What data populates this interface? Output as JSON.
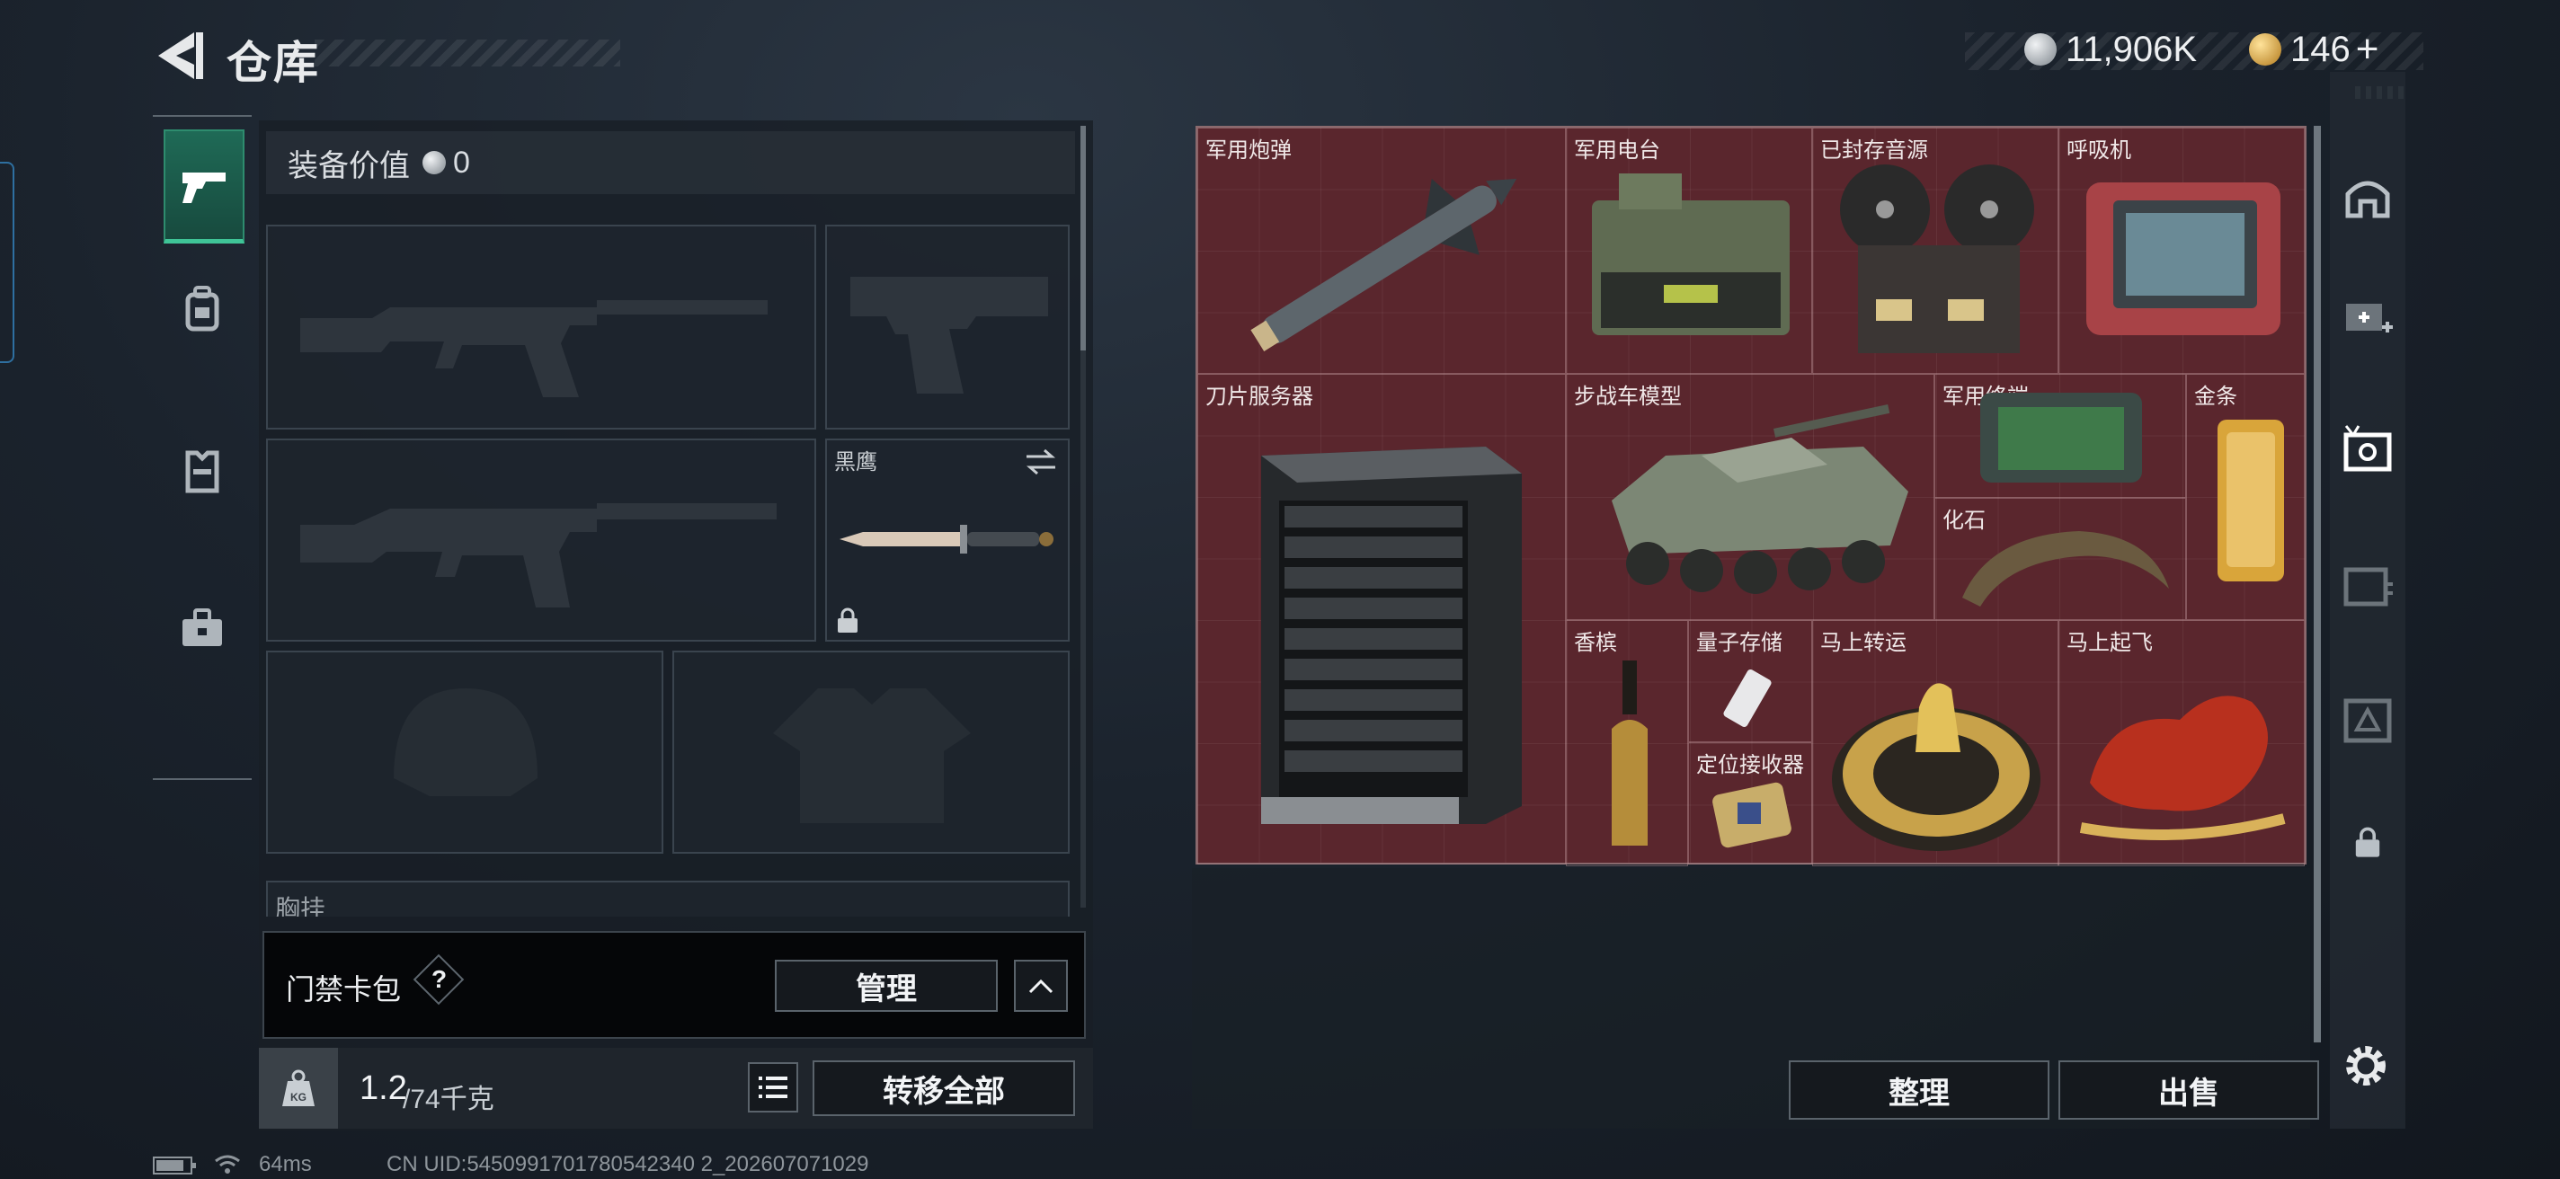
{
  "header": {
    "title": "仓库"
  },
  "currency": {
    "silver": {
      "amount": "11,906K",
      "icon": "silver-coin-icon"
    },
    "gold": {
      "amount": "146",
      "plus": "+",
      "icon": "gold-coin-icon"
    }
  },
  "sidebar_tabs": [
    {
      "name": "weapons",
      "icon": "pistol-icon",
      "active": true
    },
    {
      "name": "backpack",
      "icon": "backpack-icon",
      "active": false
    },
    {
      "name": "vest",
      "icon": "vest-icon",
      "active": false
    },
    {
      "name": "case",
      "icon": "briefcase-icon",
      "active": false
    }
  ],
  "equipment": {
    "value_label": "装备价值",
    "value": "0",
    "melee_label": "黑鹰",
    "chest_label_partial": "胸挂",
    "chest_help": "?"
  },
  "access_card": {
    "label": "门禁卡包",
    "help": "?",
    "manage_button": "管理"
  },
  "weight": {
    "current": "1.2",
    "max": "/74千克",
    "kg_icon": "KG"
  },
  "transfer_button": "转移全部",
  "storage_items": [
    {
      "label": "军用炮弹"
    },
    {
      "label": "军用电台"
    },
    {
      "label": "已封存音源"
    },
    {
      "label": "呼吸机"
    },
    {
      "label": "刀片服务器"
    },
    {
      "label": "步战车模型"
    },
    {
      "label": "军用终端"
    },
    {
      "label": "金条"
    },
    {
      "label": "化石"
    },
    {
      "label": "香槟"
    },
    {
      "label": "量子存储"
    },
    {
      "label": "定位接收器"
    },
    {
      "label": "马上转运"
    },
    {
      "label": "马上起飞"
    }
  ],
  "buttons": {
    "sort": "整理",
    "sell": "出售"
  },
  "status": {
    "ping": "64ms",
    "uid": "CN UID:5450991701780542340 2_202607071029"
  },
  "colors": {
    "accent": "#3fc497",
    "storage_bg": "#5a262d",
    "gold": "#d9a53a"
  }
}
